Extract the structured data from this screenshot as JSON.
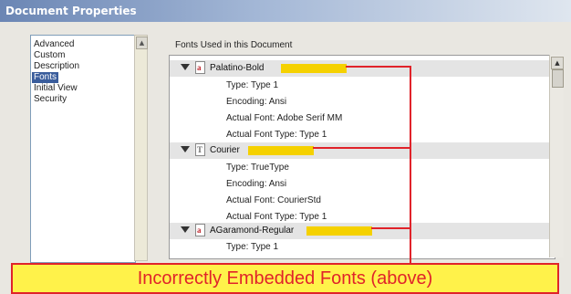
{
  "window": {
    "title": "Document Properties"
  },
  "categories": {
    "items": [
      {
        "label": "Advanced",
        "selected": false
      },
      {
        "label": "Custom",
        "selected": false
      },
      {
        "label": "Description",
        "selected": false
      },
      {
        "label": "Fonts",
        "selected": true
      },
      {
        "label": "Initial View",
        "selected": false
      },
      {
        "label": "Security",
        "selected": false
      }
    ]
  },
  "fonts_group": {
    "label": "Fonts Used in this Document",
    "fonts": [
      {
        "name": "Palatino-Bold",
        "icon": "pdf-font-icon",
        "details": [
          "Type: Type 1",
          "Encoding: Ansi",
          "Actual Font: Adobe Serif MM",
          "Actual Font Type: Type 1"
        ]
      },
      {
        "name": "Courier",
        "icon": "truetype-font-icon",
        "details": [
          "Type: TrueType",
          "Encoding: Ansi",
          "Actual Font: CourierStd",
          "Actual Font Type: Type 1"
        ]
      },
      {
        "name": "AGaramond-Regular",
        "icon": "pdf-font-icon",
        "details": [
          "Type: Type 1"
        ]
      }
    ]
  },
  "callout": {
    "text": "Incorrectly Embedded Fonts (above)"
  },
  "colors": {
    "highlight": "#f5d100",
    "callout_red": "#e0232a",
    "banner_fill": "#fff24a",
    "selection": "#3a5d9c"
  }
}
